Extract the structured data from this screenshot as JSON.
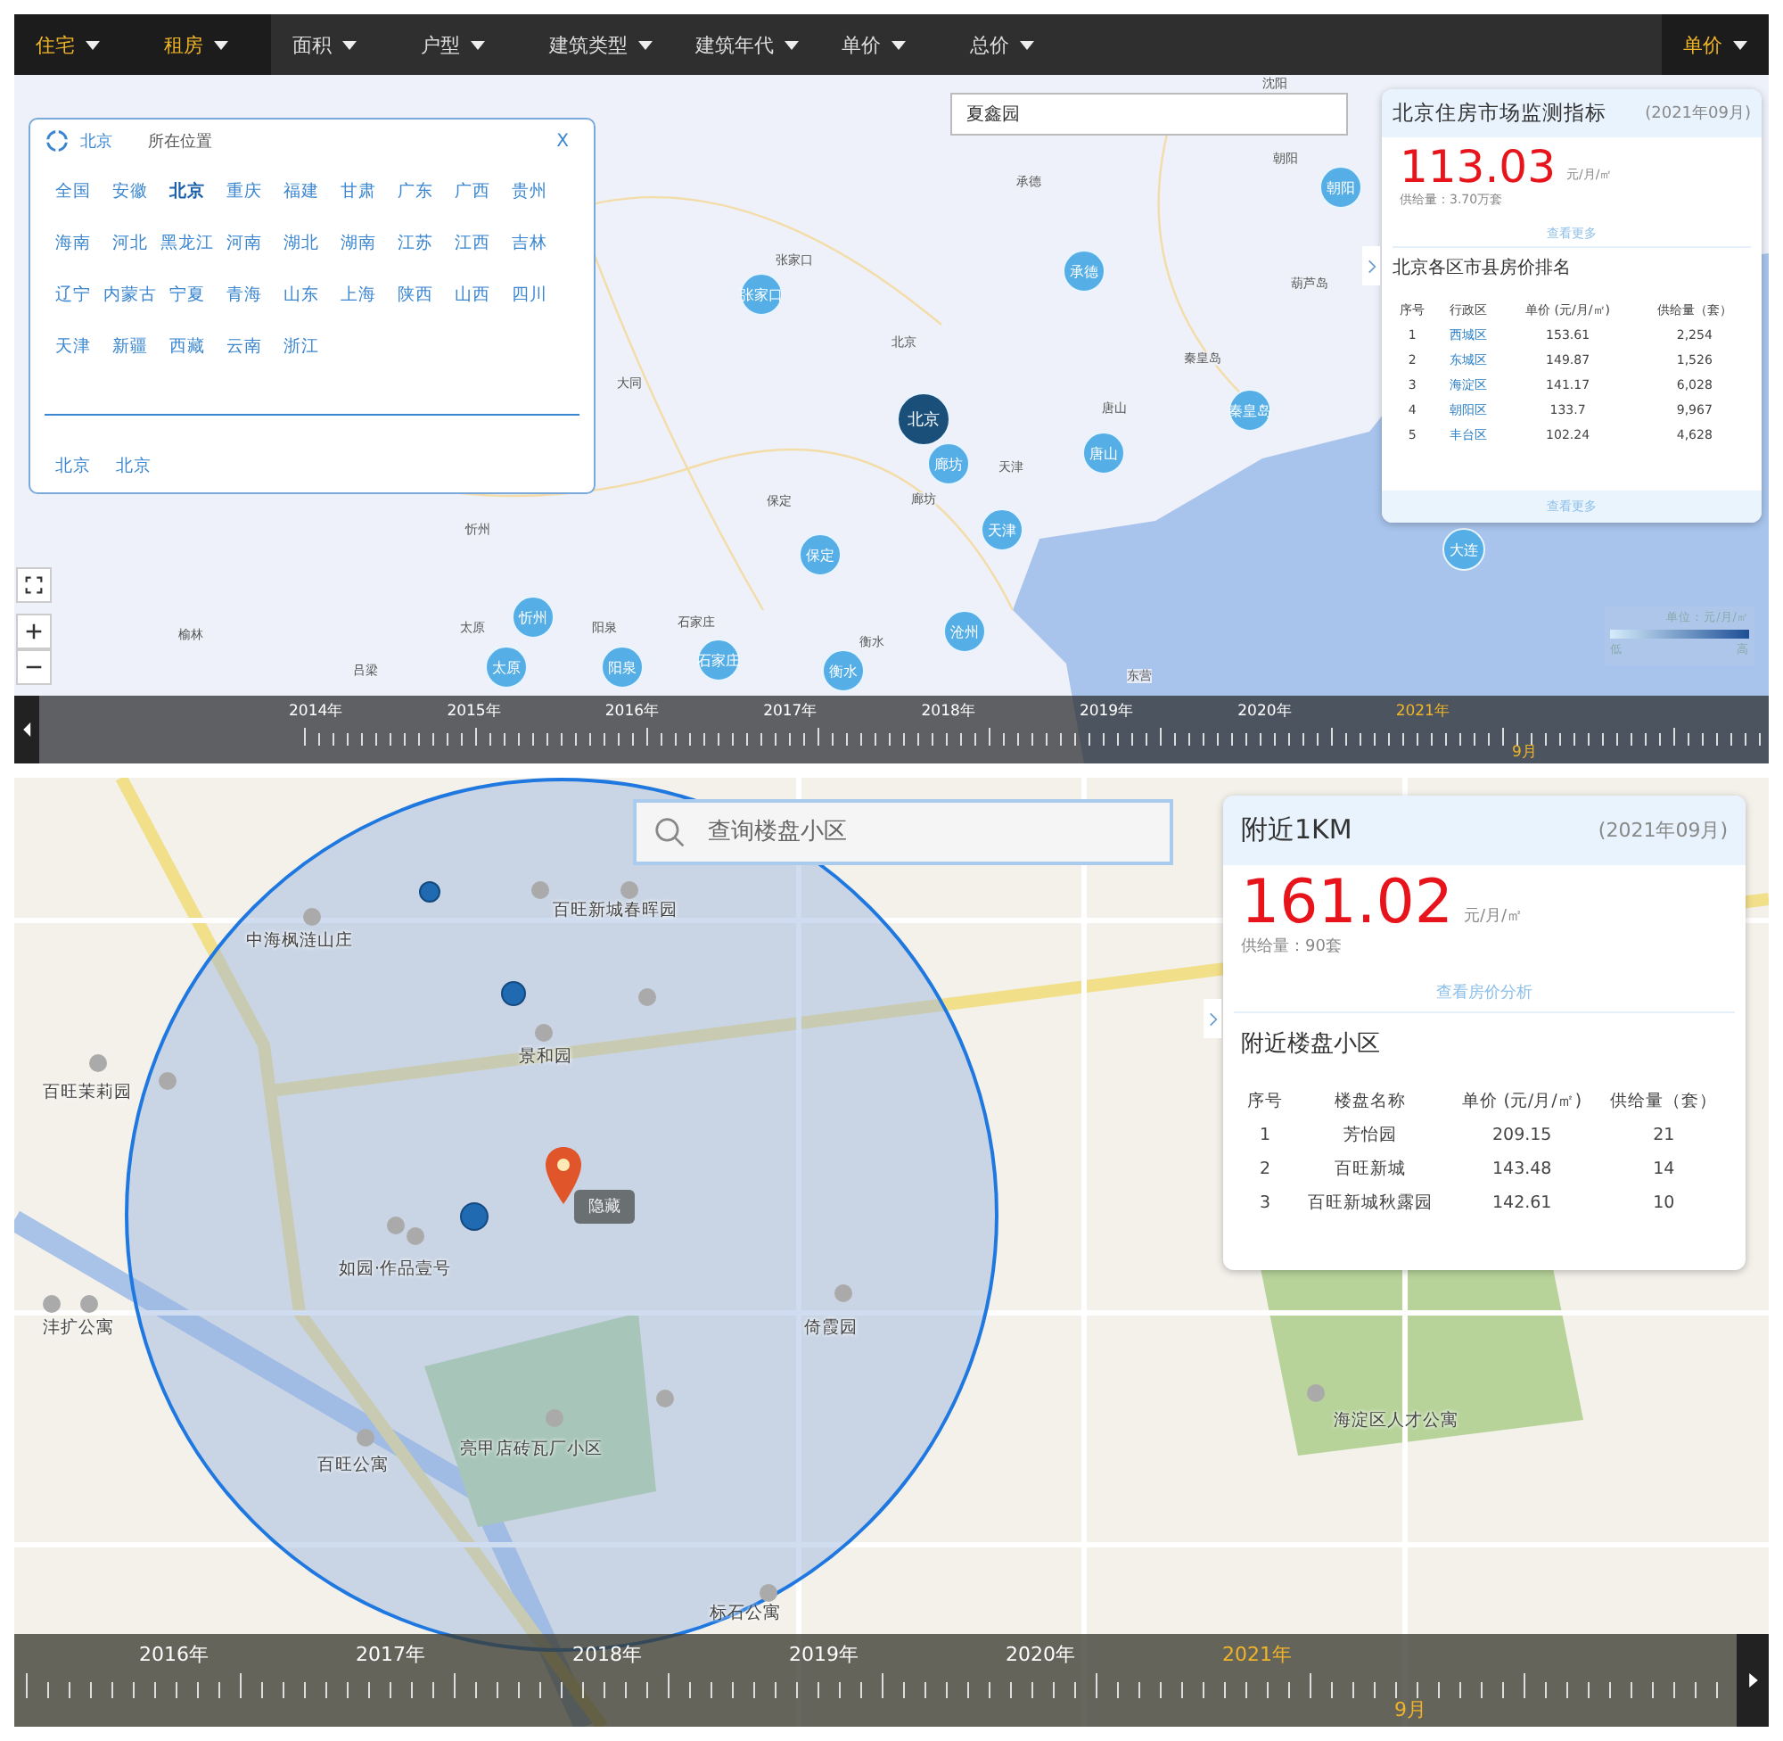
{
  "region_map": {
    "filters": [
      {
        "label": "住宅",
        "selected": true
      },
      {
        "label": "租房",
        "selected": true
      },
      {
        "label": "面积",
        "selected": false
      },
      {
        "label": "户型",
        "selected": false
      },
      {
        "label": "建筑类型",
        "selected": false
      },
      {
        "label": "建筑年代",
        "selected": false
      },
      {
        "label": "单价",
        "selected": false
      },
      {
        "label": "总价",
        "selected": false
      }
    ],
    "sort": {
      "label": "单价",
      "selected": true
    },
    "search": {
      "value": "夏鑫园"
    },
    "city_picker": {
      "current": "北京",
      "location_label": "所在位置",
      "close": "X",
      "provinces": [
        {
          "label": "全国",
          "selected": false
        },
        {
          "label": "安徽",
          "selected": false
        },
        {
          "label": "北京",
          "selected": true
        },
        {
          "label": "重庆",
          "selected": false
        },
        {
          "label": "福建",
          "selected": false
        },
        {
          "label": "甘肃",
          "selected": false
        },
        {
          "label": "广东",
          "selected": false
        },
        {
          "label": "广西",
          "selected": false
        },
        {
          "label": "贵州",
          "selected": false
        },
        {
          "label": "海南",
          "selected": false
        },
        {
          "label": "河北",
          "selected": false
        },
        {
          "label": "黑龙江",
          "selected": false
        },
        {
          "label": "河南",
          "selected": false
        },
        {
          "label": "湖北",
          "selected": false
        },
        {
          "label": "湖南",
          "selected": false
        },
        {
          "label": "江苏",
          "selected": false
        },
        {
          "label": "江西",
          "selected": false
        },
        {
          "label": "吉林",
          "selected": false
        },
        {
          "label": "辽宁",
          "selected": false
        },
        {
          "label": "内蒙古",
          "selected": false
        },
        {
          "label": "宁夏",
          "selected": false
        },
        {
          "label": "青海",
          "selected": false
        },
        {
          "label": "山东",
          "selected": false
        },
        {
          "label": "上海",
          "selected": false
        },
        {
          "label": "陕西",
          "selected": false
        },
        {
          "label": "山西",
          "selected": false
        },
        {
          "label": "四川",
          "selected": false
        },
        {
          "label": "天津",
          "selected": false
        },
        {
          "label": "新疆",
          "selected": false
        },
        {
          "label": "西藏",
          "selected": false
        },
        {
          "label": "云南",
          "selected": false
        },
        {
          "label": "浙江",
          "selected": false
        }
      ],
      "recent": [
        "北京",
        "北京"
      ]
    },
    "map_labels": [
      {
        "text": "张家口",
        "kind": "cluster"
      },
      {
        "text": "北京",
        "kind": "cluster_main"
      },
      {
        "text": "承德",
        "kind": "cluster"
      },
      {
        "text": "朝阳",
        "kind": "cluster"
      },
      {
        "text": "秦皇岛",
        "kind": "cluster"
      },
      {
        "text": "唐山",
        "kind": "cluster"
      },
      {
        "text": "廊坊",
        "kind": "cluster"
      },
      {
        "text": "天津",
        "kind": "cluster"
      },
      {
        "text": "保定",
        "kind": "cluster"
      },
      {
        "text": "沧州",
        "kind": "cluster"
      },
      {
        "text": "忻州",
        "kind": "cluster"
      },
      {
        "text": "太原",
        "kind": "cluster"
      },
      {
        "text": "阳泉",
        "kind": "cluster"
      },
      {
        "text": "石家庄",
        "kind": "cluster"
      },
      {
        "text": "衡水",
        "kind": "cluster"
      },
      {
        "text": "大连",
        "kind": "cluster"
      },
      {
        "text": "张家口",
        "kind": "place"
      },
      {
        "text": "北京",
        "kind": "place"
      },
      {
        "text": "承德",
        "kind": "place"
      },
      {
        "text": "朝阳",
        "kind": "place"
      },
      {
        "text": "葫芦岛",
        "kind": "place"
      },
      {
        "text": "秦皇岛",
        "kind": "place"
      },
      {
        "text": "唐山",
        "kind": "place"
      },
      {
        "text": "廊坊",
        "kind": "place"
      },
      {
        "text": "天津",
        "kind": "place"
      },
      {
        "text": "保定",
        "kind": "place"
      },
      {
        "text": "大同",
        "kind": "place"
      },
      {
        "text": "忻州",
        "kind": "place"
      },
      {
        "text": "太原",
        "kind": "place"
      },
      {
        "text": "阳泉",
        "kind": "place"
      },
      {
        "text": "石家庄",
        "kind": "place"
      },
      {
        "text": "衡水",
        "kind": "place"
      },
      {
        "text": "榆林",
        "kind": "place"
      },
      {
        "text": "吕梁",
        "kind": "place"
      },
      {
        "text": "东营",
        "kind": "place"
      },
      {
        "text": "沈阳",
        "kind": "place"
      }
    ],
    "index_card": {
      "title": "北京住房市场监测指标",
      "date": "(2021年09月)",
      "price": "113.03",
      "unit": "元/月/㎡",
      "supply": "供给量：3.70万套",
      "more_link": "查看更多",
      "ranking_title": "北京各区市县房价排名",
      "columns": [
        "序号",
        "行政区",
        "单价 (元/月/㎡)",
        "供给量（套）"
      ],
      "rows": [
        [
          "1",
          "西城区",
          "153.61",
          "2,254"
        ],
        [
          "2",
          "东城区",
          "149.87",
          "1,526"
        ],
        [
          "3",
          "海淀区",
          "141.17",
          "6,028"
        ],
        [
          "4",
          "朝阳区",
          "133.7",
          "9,967"
        ],
        [
          "5",
          "丰台区",
          "102.24",
          "4,628"
        ]
      ],
      "footer_link": "查看更多"
    },
    "legend": {
      "unit": "单位：元/月/㎡",
      "low": "低",
      "high": "高"
    },
    "timeline": {
      "years": [
        {
          "label": "2014年",
          "selected": false
        },
        {
          "label": "2015年",
          "selected": false
        },
        {
          "label": "2016年",
          "selected": false
        },
        {
          "label": "2017年",
          "selected": false
        },
        {
          "label": "2018年",
          "selected": false
        },
        {
          "label": "2019年",
          "selected": false
        },
        {
          "label": "2020年",
          "selected": false
        },
        {
          "label": "2021年",
          "selected": true
        }
      ],
      "month": "9月"
    }
  },
  "nearby_map": {
    "search": {
      "placeholder": "查询楼盘小区"
    },
    "map_labels": [
      {
        "text": "中海枫涟山庄",
        "kind": "place"
      },
      {
        "text": "百旺新城春晖园",
        "kind": "place"
      },
      {
        "text": "景和园",
        "kind": "place"
      },
      {
        "text": "百旺茉莉园",
        "kind": "place"
      },
      {
        "text": "如园·作品壹号",
        "kind": "place"
      },
      {
        "text": "沣扩公寓",
        "kind": "place"
      },
      {
        "text": "倚霞园",
        "kind": "place"
      },
      {
        "text": "亮甲店砖瓦厂小区",
        "kind": "place"
      },
      {
        "text": "百旺公寓",
        "kind": "place"
      },
      {
        "text": "海淀区人才公寓",
        "kind": "place"
      },
      {
        "text": "标石公寓",
        "kind": "place"
      }
    ],
    "pin_tooltip": "隐藏",
    "card": {
      "title": "附近1KM",
      "date": "(2021年09月)",
      "price": "161.02",
      "unit": "元/月/㎡",
      "supply": "供给量：90套",
      "link": "查看房价分析",
      "section_title": "附近楼盘小区",
      "columns": [
        "序号",
        "楼盘名称",
        "单价 (元/月/㎡)",
        "供给量（套）"
      ],
      "rows": [
        [
          "1",
          "芳怡园",
          "209.15",
          "21"
        ],
        [
          "2",
          "百旺新城",
          "143.48",
          "14"
        ],
        [
          "3",
          "百旺新城秋露园",
          "142.61",
          "10"
        ]
      ]
    },
    "timeline": {
      "years": [
        {
          "label": "2016年",
          "selected": false
        },
        {
          "label": "2017年",
          "selected": false
        },
        {
          "label": "2018年",
          "selected": false
        },
        {
          "label": "2019年",
          "selected": false
        },
        {
          "label": "2020年",
          "selected": false
        },
        {
          "label": "2021年",
          "selected": true
        }
      ],
      "month": "9月"
    }
  }
}
